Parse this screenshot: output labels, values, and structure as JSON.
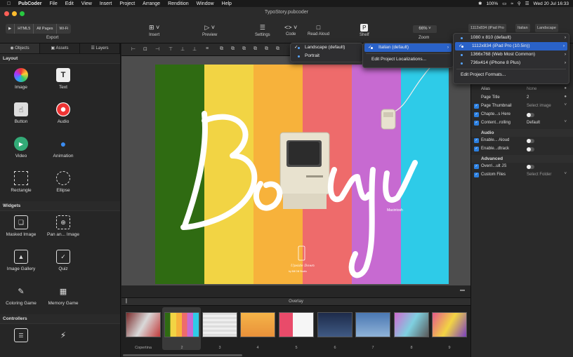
{
  "menubar": {
    "app": "PubCoder",
    "items": [
      "File",
      "Edit",
      "View",
      "Insert",
      "Project",
      "Arrange",
      "Rendition",
      "Window",
      "Help"
    ],
    "battery": "100%",
    "datetime": "Wed 20 Jul 16:33"
  },
  "window": {
    "title": "TypoStory.pubcoder"
  },
  "toolbar": {
    "export_formats": [
      "HTML5",
      "All Pages",
      "Wi-Fi"
    ],
    "export_label": "Export",
    "insert_label": "Insert",
    "preview_label": "Preview",
    "settings_label": "Settings",
    "code_label": "Code",
    "read_aloud_label": "Read Aloud",
    "shelf_label": "Shelf",
    "zoom_value": "66%",
    "zoom_label": "Zoom",
    "device_label": "1112x834 (iPad Pro",
    "language_label": "Italian",
    "orientation_label": "Landscape"
  },
  "sidebar": {
    "tabs": [
      "Objects",
      "Assets",
      "Layers"
    ],
    "sections": [
      {
        "title": "Layout",
        "items": [
          "Image",
          "Text",
          "Button",
          "Audio",
          "Video",
          "Animation",
          "Rectangle",
          "Ellipse"
        ]
      },
      {
        "title": "Widgets",
        "items": [
          "Masked Image",
          "Pan an... Image",
          "Image Gallery",
          "Quiz",
          "Coloring Game",
          "Memory Game"
        ]
      },
      {
        "title": "Controllers",
        "items": []
      }
    ]
  },
  "canvas": {
    "stripe_colors": [
      "#2f6b12",
      "#f2d444",
      "#f7b23b",
      "#ee6b6b",
      "#c76ad1",
      "#2ecbe8"
    ],
    "title_text": "Bonju",
    "subtitle": "Macintosh",
    "logo_caption": "Upside Down",
    "logo_sub": "by Bill Dill Studio"
  },
  "overlay": {
    "label": "Overlay"
  },
  "filmstrip": {
    "pages": [
      {
        "label": "Copertina"
      },
      {
        "label": "2"
      },
      {
        "label": "3"
      },
      {
        "label": "4"
      },
      {
        "label": "5"
      },
      {
        "label": "6"
      },
      {
        "label": "7"
      },
      {
        "label": "8"
      },
      {
        "label": "9"
      }
    ]
  },
  "inspector": {
    "rows": [
      {
        "label": "Alias",
        "value": "None"
      },
      {
        "label": "Page Title",
        "value": "2"
      },
      {
        "label": "Page Thumbnail",
        "value": "Select image"
      },
      {
        "label": "Chapte...s Here",
        "value": ""
      },
      {
        "label": "Content...rolling",
        "value": "Default"
      }
    ],
    "audio_title": "Audio",
    "audio_rows": [
      {
        "label": "Enable... Aloud"
      },
      {
        "label": "Enable...dtrack"
      }
    ],
    "advanced_title": "Advanced",
    "advanced_rows": [
      {
        "label": "Overri...ult JS",
        "value": ""
      },
      {
        "label": "Custom Files",
        "value": "Select Folder"
      }
    ]
  },
  "menus": {
    "orientation": [
      "Landscape (default)",
      "Portrait"
    ],
    "language": {
      "selected": "Italian (default)",
      "edit": "Edit Project Localizations..."
    },
    "formats": {
      "items": [
        "1080 x 810 (default)",
        "1112x834 (iPad Pro (10.5in))",
        "1366x768 (Web Most Common)",
        "736x414 (iPhone 8 Plus)"
      ],
      "edit": "Edit Project Formats..."
    }
  }
}
